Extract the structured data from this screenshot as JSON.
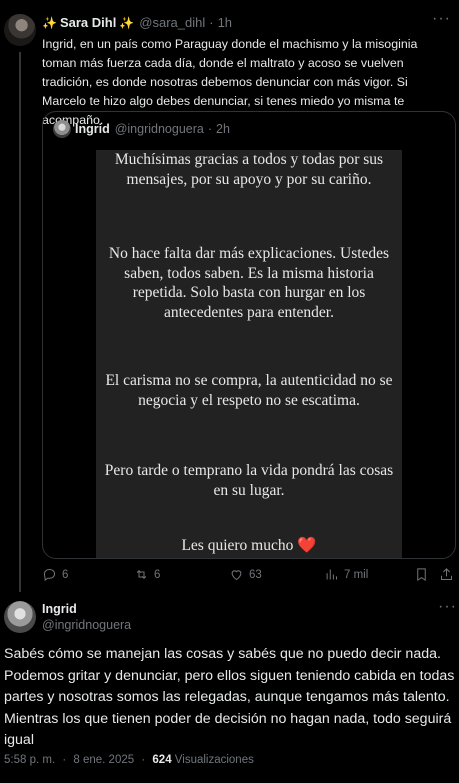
{
  "main_tweet": {
    "author_name": "Sara Dihl",
    "name_emoji": "✨",
    "handle": "@sara_dihl",
    "time": "1h",
    "text": "Ingrid, en un país como Paraguay donde el machismo y la misoginia toman más fuerza cada día, donde el maltrato y acoso se vuelven tradición, es donde nosotras debemos denunciar con más vigor. Si Marcelo te hizo algo debes denunciar, si tenes miedo yo misma te acompaño.",
    "more_label": "···"
  },
  "quoted_tweet": {
    "author_name": "Ingrid",
    "handle": "@ingridnoguera",
    "time": "2h",
    "story_paragraphs": [
      "Muchísimas gracias a todos y todas por sus mensajes, por su apoyo y por su cariño.",
      "No hace falta dar más explicaciones. Ustedes saben, todos saben. Es la misma historia repetida. Solo basta con hurgar en los antecedentes para entender.",
      "El carisma no se compra, la autenticidad no se negocia y el respeto no se escatima.",
      "Pero tarde o temprano la vida pondrá las cosas en su lugar.",
      "Les quiero mucho"
    ],
    "heart_emoji": "❤️"
  },
  "actions": {
    "replies": "6",
    "reposts": "6",
    "likes": "63",
    "views": "7 mil"
  },
  "reply_tweet": {
    "author_name": "Ingrid",
    "handle": "@ingridnoguera",
    "more_label": "···",
    "text": "Sabés cómo se manejan las cosas y sabés que no puedo decir nada. Podemos gritar y denunciar, pero ellos siguen teniendo cabida en todas partes y nosotras somos las relegadas, aunque tengamos más talento. Mientras los que tienen poder de decisión no hagan nada, todo seguirá igual",
    "time": "5:58 p. m.",
    "date": "8 ene. 2025",
    "views_count": "624",
    "views_label": "Visualizaciones"
  },
  "colors": {
    "background": "#000000",
    "text_primary": "#e7e9ea",
    "text_secondary": "#71767b",
    "border": "#2f3336",
    "story_bg": "#222222",
    "heart": "#e0245e"
  }
}
